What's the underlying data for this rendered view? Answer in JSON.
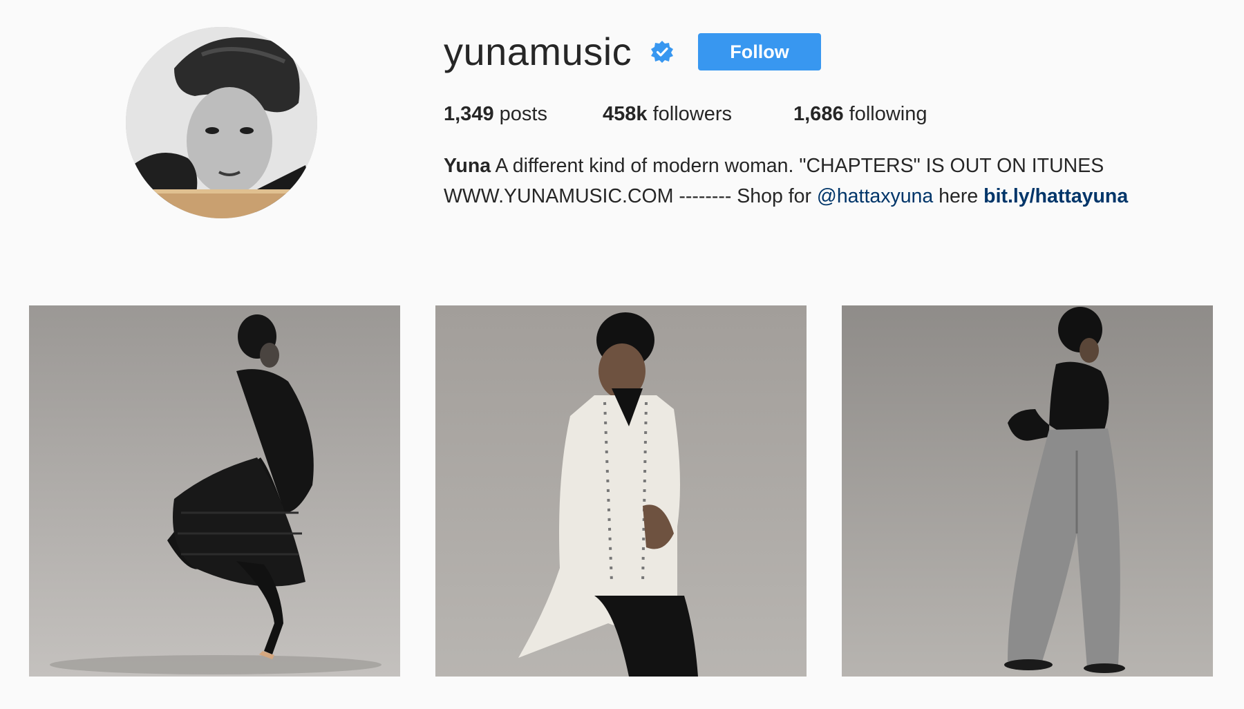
{
  "profile": {
    "username": "yunamusic",
    "verified": true,
    "follow_label": "Follow",
    "stats": {
      "posts_count": "1,349",
      "posts_label": "posts",
      "followers_count": "458k",
      "followers_label": "followers",
      "following_count": "1,686",
      "following_label": "following"
    },
    "bio": {
      "name": "Yuna",
      "text_line1": " A different kind of modern woman. \"CHAPTERS\" IS OUT ON ITUNES",
      "text_line2": "WWW.YUNAMUSIC.COM -------- Shop for ",
      "mention": "@hattaxyuna",
      "text_mid": " here ",
      "link": "bit.ly/hattayuna"
    }
  },
  "colors": {
    "background": "#fafafa",
    "follow_button": "#3897f0",
    "verified_badge": "#3897f0",
    "link": "#003569",
    "text": "#262626"
  },
  "icons": {
    "verified": "verified-badge-icon"
  },
  "posts": [
    {
      "description": "black fringed dress"
    },
    {
      "description": "white military jacket"
    },
    {
      "description": "grey wide-leg trousers"
    }
  ]
}
